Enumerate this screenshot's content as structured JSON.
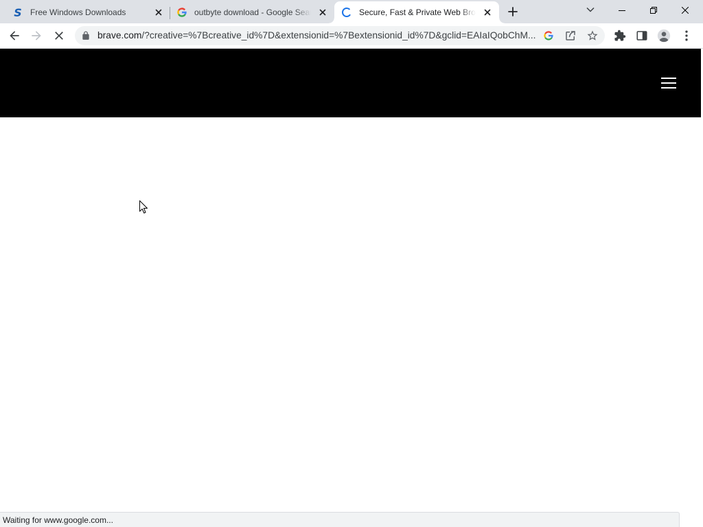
{
  "colors": {
    "tabstrip_bg": "#dee1e6",
    "toolbar_bg": "#ffffff",
    "omnibox_bg": "#f1f3f4",
    "icon": "#5f6368",
    "spinner": "#1a73e8",
    "page_header_bg": "#000000",
    "page_bg": "#ffffff",
    "status_bg": "#f1f3f4"
  },
  "tabs": [
    {
      "title": "Free Windows Downloads",
      "favicon": "s-logo-icon",
      "favicon_letter": "S",
      "active": false
    },
    {
      "title": "outbyte download - Google Sear",
      "favicon": "google-g-icon",
      "active": false
    },
    {
      "title": "Secure, Fast & Private Web Brow",
      "favicon": "loading-spinner-icon",
      "active": true
    }
  ],
  "tabstrip": {
    "new_tab_icon": "plus-icon",
    "tab_search_icon": "chevron-down-icon"
  },
  "window_controls": [
    "minimize-icon",
    "restore-icon",
    "close-icon"
  ],
  "toolbar": {
    "back_icon": "arrow-left-icon",
    "forward_icon": "arrow-right-icon",
    "forward_enabled": false,
    "stop_icon": "close-icon",
    "extensions_icon": "puzzle-icon",
    "side_panel_icon": "side-panel-icon",
    "profile_icon": "avatar-icon",
    "menu_icon": "kebab-icon"
  },
  "omnibox": {
    "security_icon": "lock-icon",
    "url_domain": "brave.com",
    "url_path": "/?creative=%7Bcreative_id%7D&extensionid=%7Bextensionid_id%7D&gclid=EAIaIQobChM...",
    "action_icons": [
      "google-g-icon",
      "share-icon",
      "star-icon"
    ]
  },
  "page": {
    "menu_icon": "hamburger-icon"
  },
  "status_bubble": {
    "text": "Waiting for www.google.com..."
  },
  "cursor": "arrow-cursor-icon"
}
